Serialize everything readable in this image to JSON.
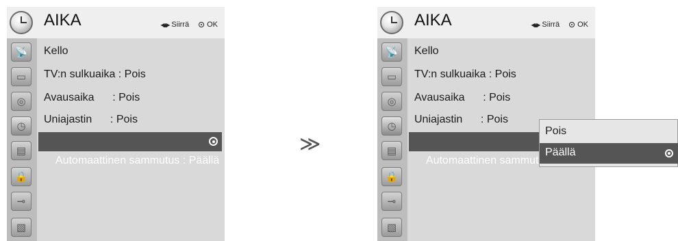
{
  "left_panel": {
    "title": "AIKA",
    "hint_move": "Siirrä",
    "hint_ok": "OK",
    "items": [
      {
        "label": "Kello"
      },
      {
        "label": "TV:n sulkuaika : Pois"
      },
      {
        "label": "Avausaika      : Pois"
      },
      {
        "label": "Uniajastin      : Pois"
      },
      {
        "label": "Automaattinen sammutus : Päällä"
      }
    ]
  },
  "right_panel": {
    "title": "AIKA",
    "hint_move": "Siirrä",
    "hint_ok": "OK",
    "items": [
      {
        "label": "Kello"
      },
      {
        "label": "TV:n sulkuaika : Pois"
      },
      {
        "label": "Avausaika      : Pois"
      },
      {
        "label": "Uniajastin      : Pois"
      },
      {
        "label": "Automaattinen sammutu"
      }
    ],
    "popup": {
      "options": [
        {
          "label": "Pois"
        },
        {
          "label": "Päällä"
        }
      ]
    }
  },
  "transition_arrow": "≫"
}
